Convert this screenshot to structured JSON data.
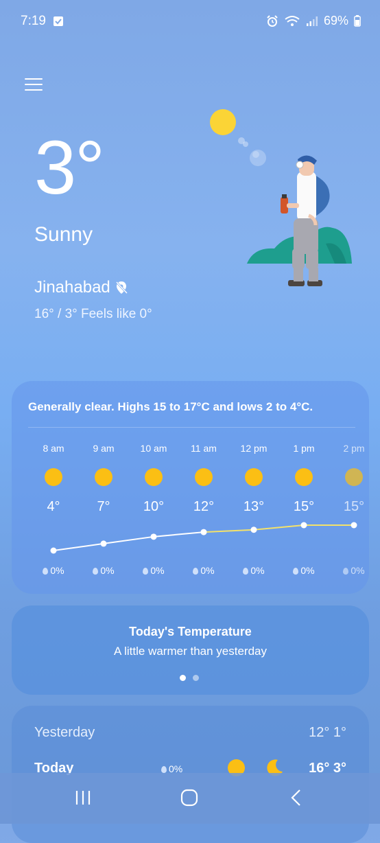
{
  "status": {
    "time": "7:19",
    "battery": "69%",
    "icons": [
      "check-icon",
      "alarm-icon",
      "wifi-icon",
      "signal-icon",
      "battery-icon"
    ]
  },
  "current": {
    "temperature": "3°",
    "condition": "Sunny",
    "location": "Jinahabad",
    "range": "16° / 3° Feels like 0°"
  },
  "hourly": {
    "summary": "Generally clear. Highs 15 to 17°C and lows 2 to 4°C.",
    "hours": [
      {
        "label": "8 am",
        "temp": "4°",
        "precip": "0%",
        "value": 4
      },
      {
        "label": "9 am",
        "temp": "7°",
        "precip": "0%",
        "value": 7
      },
      {
        "label": "10 am",
        "temp": "10°",
        "precip": "0%",
        "value": 10
      },
      {
        "label": "11 am",
        "temp": "12°",
        "precip": "0%",
        "value": 12
      },
      {
        "label": "12 pm",
        "temp": "13°",
        "precip": "0%",
        "value": 13
      },
      {
        "label": "1 pm",
        "temp": "15°",
        "precip": "0%",
        "value": 15
      },
      {
        "label": "2 pm",
        "temp": "15°",
        "precip": "0%",
        "value": 15
      }
    ]
  },
  "today_temperature": {
    "title": "Today's Temperature",
    "subtitle": "A little warmer than yesterday",
    "page_count": 2,
    "active_page": 1
  },
  "daily": {
    "yesterday": {
      "label": "Yesterday",
      "temps": "12° 1°"
    },
    "today": {
      "label": "Today",
      "precip": "0%",
      "temps": "16° 3°"
    }
  },
  "colors": {
    "sun": "#fbbf14",
    "accent_line": "#f4e26a"
  }
}
